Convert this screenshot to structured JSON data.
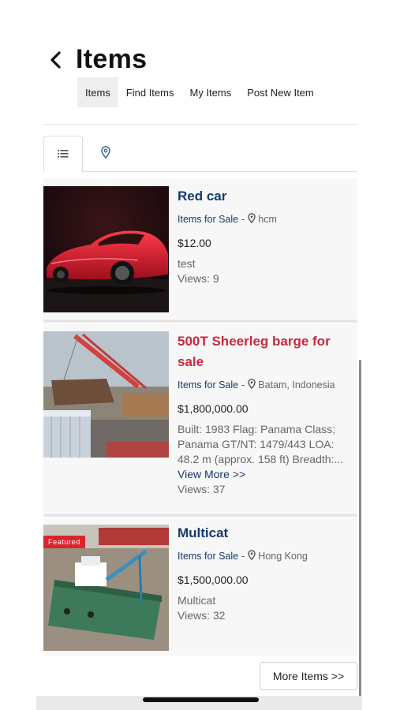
{
  "header": {
    "title": "Items"
  },
  "subnav": [
    {
      "label": "Items",
      "active": true
    },
    {
      "label": "Find Items",
      "active": false
    },
    {
      "label": "My Items",
      "active": false
    },
    {
      "label": "Post New Item",
      "active": false
    }
  ],
  "view_tabs": [
    {
      "icon": "list-icon",
      "active": true
    },
    {
      "icon": "map-pin-icon",
      "active": false
    }
  ],
  "listings": [
    {
      "title": "Red car",
      "category": "Items for Sale",
      "separator": "-",
      "location": "hcm",
      "price": "$12.00",
      "description": "test",
      "views": "Views: 9",
      "title_color": "#173a6a"
    },
    {
      "title": "500T Sheerleg barge for sale",
      "category": "Items for Sale",
      "separator": "-",
      "location": "Batam, Indonesia",
      "price": "$1,800,000.00",
      "description": "Built: 1983 Flag: Panama Class; Panama GT/NT: 1479/443 LOA: 48.2 m (approx. 158 ft) Breadth:...",
      "view_more": "View More >>",
      "views": "Views: 37",
      "title_color": "#c8283c"
    },
    {
      "title": "Multicat",
      "category": "Items for Sale",
      "separator": "-",
      "location": "Hong Kong",
      "price": "$1,500,000.00",
      "description": "Multicat",
      "views": "Views: 32",
      "badge": "Featured",
      "title_color": "#173a6a"
    }
  ],
  "more_button": "More Items >>",
  "colors": {
    "accent": "#173a6a",
    "featured": "#d9262e",
    "highlight_title": "#c8283c"
  }
}
